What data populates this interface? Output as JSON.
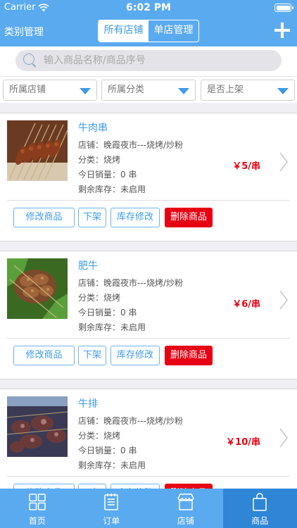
{
  "status": {
    "carrier": "Carrier",
    "time": "6:02 PM"
  },
  "nav": {
    "left_label": "类别管理",
    "seg_all": "所有店铺",
    "seg_single": "单店管理"
  },
  "search": {
    "placeholder": "输入商品名称/商品序号"
  },
  "filters": {
    "store": "所属店铺",
    "category": "所属分类",
    "listed": "是否上架"
  },
  "labels": {
    "store": "店铺：",
    "category": "分类：",
    "sales": "今日销量：",
    "stock": "剩余库存："
  },
  "actions": {
    "edit": "修改商品",
    "off": "下架",
    "stock_edit": "库存修改",
    "delete": "删除商品"
  },
  "products": [
    {
      "name": "牛肉串",
      "store": "晚霞夜市---烧烤/炒粉",
      "category": "烧烤",
      "sales": "0 串",
      "stock": "未启用",
      "price": "￥5/串"
    },
    {
      "name": "肥牛",
      "store": "晚霞夜市---烧烤/炒粉",
      "category": "烧烤",
      "sales": "0 串",
      "stock": "未启用",
      "price": "￥6/串"
    },
    {
      "name": "牛排",
      "store": "晚霞夜市---烧烤/炒粉",
      "category": "烧烤",
      "sales": "0 串",
      "stock": "未启用",
      "price": "￥10/串"
    }
  ],
  "tabs": {
    "home": "首页",
    "orders": "订单",
    "store": "店铺",
    "goods": "商品"
  }
}
